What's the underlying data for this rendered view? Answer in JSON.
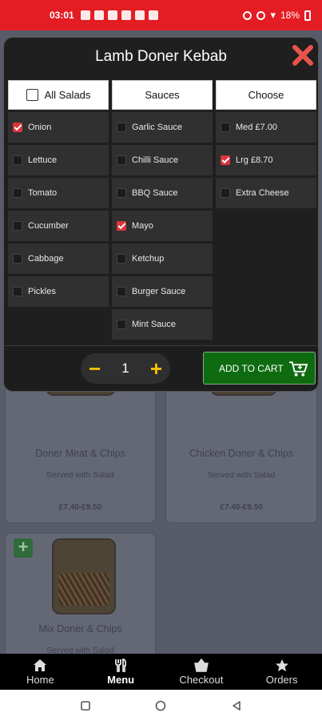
{
  "status_bar": {
    "time": "03:01",
    "battery": "18%"
  },
  "modal": {
    "title": "Lamb Doner Kebab",
    "columns": {
      "salads": {
        "header": "All Salads",
        "options": [
          {
            "label": "Onion",
            "checked": true
          },
          {
            "label": "Lettuce",
            "checked": false
          },
          {
            "label": "Tomato",
            "checked": false
          },
          {
            "label": "Cucumber",
            "checked": false
          },
          {
            "label": "Cabbage",
            "checked": false
          },
          {
            "label": "Pickles",
            "checked": false
          }
        ]
      },
      "sauces": {
        "header": "Sauces",
        "options": [
          {
            "label": "Garlic Sauce",
            "checked": false
          },
          {
            "label": "Chilli Sauce",
            "checked": false
          },
          {
            "label": "BBQ Sauce",
            "checked": false
          },
          {
            "label": "Mayo",
            "checked": true
          },
          {
            "label": "Ketchup",
            "checked": false
          },
          {
            "label": "Burger Sauce",
            "checked": false
          },
          {
            "label": "Mint Sauce",
            "checked": false
          }
        ]
      },
      "choose": {
        "header": "Choose",
        "options": [
          {
            "label": "Med £7.00",
            "checked": false
          },
          {
            "label": "Lrg £8.70",
            "checked": true
          },
          {
            "label": "Extra Cheese",
            "checked": false
          }
        ]
      }
    },
    "quantity": "1",
    "add_to_cart_label": "ADD TO CART",
    "colors": {
      "accent": "#f5c000",
      "cart_button": "#0e6b10",
      "checkbox": "#d8363c",
      "status_bar": "#e41c24"
    }
  },
  "menu_cards": [
    {
      "name": "Doner Meat & Chips",
      "desc": "Served with Salad",
      "price": "£7.40-£9.50"
    },
    {
      "name": "Chicken Doner & Chips",
      "desc": "Served with Salad",
      "price": "£7.40-£9.50"
    },
    {
      "name": "Mix Doner & Chips",
      "desc": "Served with Salad"
    }
  ],
  "bottom_nav": [
    {
      "label": "Home",
      "icon": "home-icon"
    },
    {
      "label": "Menu",
      "icon": "cutlery-icon",
      "active": true
    },
    {
      "label": "Checkout",
      "icon": "basket-icon"
    },
    {
      "label": "Orders",
      "icon": "star-icon"
    }
  ]
}
